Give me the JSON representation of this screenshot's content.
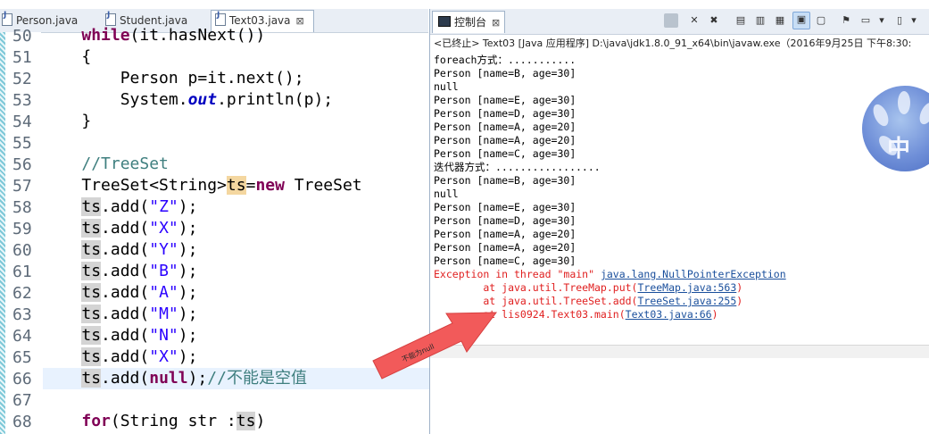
{
  "editor": {
    "tabs": [
      {
        "label": "Person.java"
      },
      {
        "label": "Student.java"
      },
      {
        "label": "Text03.java",
        "close": "⊠"
      }
    ],
    "lines": [
      {
        "num": "50",
        "text": "    while(it.hasNext())"
      },
      {
        "num": "51",
        "text": "    {"
      },
      {
        "num": "52",
        "text": "        Person p=it.next();"
      },
      {
        "num": "53",
        "text": "        System.out.println(p);"
      },
      {
        "num": "54",
        "text": "    }"
      },
      {
        "num": "55",
        "text": ""
      },
      {
        "num": "56",
        "text": "    //TreeSet"
      },
      {
        "num": "57",
        "text": "    TreeSet<String>ts=new TreeSet"
      },
      {
        "num": "58",
        "text": "    ts.add(\"Z\");"
      },
      {
        "num": "59",
        "text": "    ts.add(\"X\");"
      },
      {
        "num": "60",
        "text": "    ts.add(\"Y\");"
      },
      {
        "num": "61",
        "text": "    ts.add(\"B\");"
      },
      {
        "num": "62",
        "text": "    ts.add(\"A\");"
      },
      {
        "num": "63",
        "text": "    ts.add(\"M\");"
      },
      {
        "num": "64",
        "text": "    ts.add(\"N\");"
      },
      {
        "num": "65",
        "text": "    ts.add(\"X\");"
      },
      {
        "num": "66",
        "text": "    ts.add(null);//不能是空值"
      },
      {
        "num": "67",
        "text": ""
      },
      {
        "num": "68",
        "text": "    for(String str :ts)"
      }
    ]
  },
  "console": {
    "tab_label": "控制台",
    "tab_close": "⊠",
    "info": "<已终止> Text03 [Java 应用程序] D:\\java\\jdk1.8.0_91_x64\\bin\\javaw.exe（2016年9月25日 下午8:30:",
    "output": [
      {
        "text": "foreach方式：...........",
        "type": "out"
      },
      {
        "text": "Person [name=B, age=30]",
        "type": "out"
      },
      {
        "text": "null",
        "type": "out"
      },
      {
        "text": "Person [name=E, age=30]",
        "type": "out"
      },
      {
        "text": "Person [name=D, age=30]",
        "type": "out"
      },
      {
        "text": "Person [name=A, age=20]",
        "type": "out"
      },
      {
        "text": "Person [name=A, age=20]",
        "type": "out"
      },
      {
        "text": "Person [name=C, age=30]",
        "type": "out"
      },
      {
        "text": "迭代器方式：.................",
        "type": "out"
      },
      {
        "text": "Person [name=B, age=30]",
        "type": "out"
      },
      {
        "text": "null",
        "type": "out"
      },
      {
        "text": "Person [name=E, age=30]",
        "type": "out"
      },
      {
        "text": "Person [name=D, age=30]",
        "type": "out"
      },
      {
        "text": "Person [name=A, age=20]",
        "type": "out"
      },
      {
        "text": "Person [name=A, age=20]",
        "type": "out"
      },
      {
        "text": "Person [name=C, age=30]",
        "type": "out"
      }
    ],
    "exception": {
      "prefix": "Exception in thread \"main\" ",
      "link": "java.lang.NullPointerException",
      "frames": [
        {
          "prefix": "        at java.util.TreeMap.put(",
          "link": "TreeMap.java:563",
          "suffix": ")"
        },
        {
          "prefix": "        at java.util.TreeSet.add(",
          "link": "TreeSet.java:255",
          "suffix": ")"
        },
        {
          "prefix": "        at lis0924.Text03.main(",
          "link": "Text03.java:66",
          "suffix": ")"
        }
      ]
    }
  },
  "annotation": {
    "label": "不能为null",
    "color": "#f25a5a"
  },
  "watermark": {
    "chars": [
      "中"
    ]
  }
}
